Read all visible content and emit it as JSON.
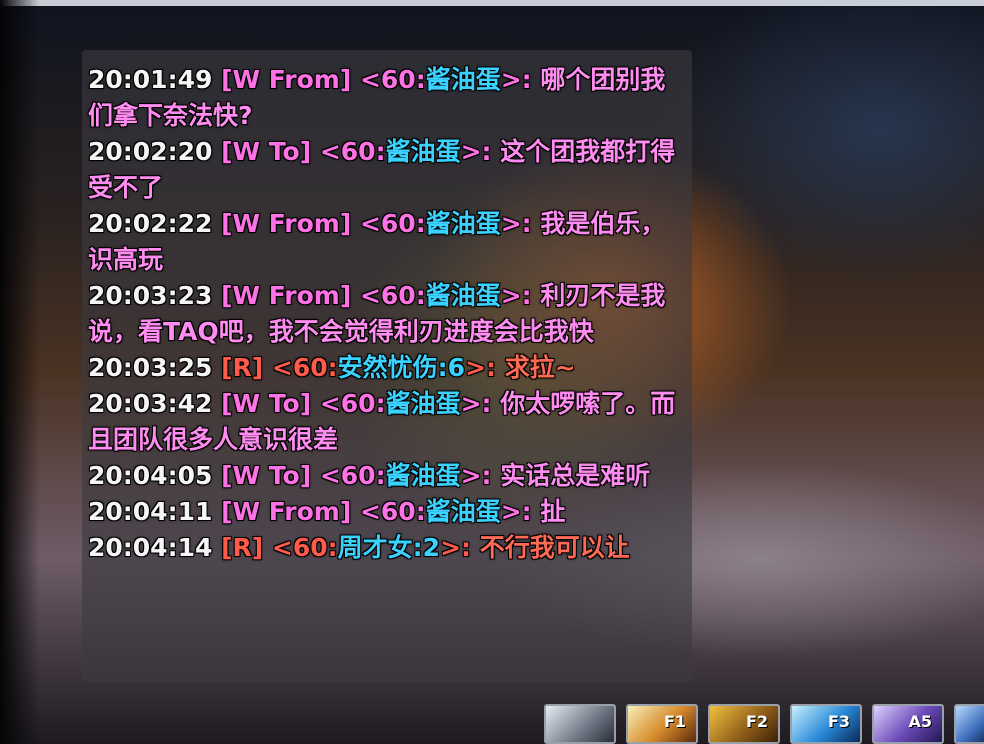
{
  "chat": {
    "messages": [
      {
        "time": "20:01:49",
        "channel": "[W From]",
        "open": " <60:",
        "name": "酱油蛋",
        "close": ">: ",
        "text": "哪个团别我们拿下奈法快?"
      },
      {
        "time": "20:02:20",
        "channel": "[W To]",
        "open": " <60:",
        "name": "酱油蛋",
        "close": ">: ",
        "text": "这个团我都打得受不了"
      },
      {
        "time": "20:02:22",
        "channel": "[W From]",
        "open": " <60:",
        "name": "酱油蛋",
        "close": ">: ",
        "text": "我是伯乐，识高玩"
      },
      {
        "time": "20:03:23",
        "channel": "[W From]",
        "open": " <60:",
        "name": "酱油蛋",
        "close": ">: ",
        "text": "利刃不是我说，看TAQ吧，我不会觉得利刃进度会比我快"
      },
      {
        "time": "20:03:25",
        "channel": "[R]",
        "open": " <60:",
        "name": "安然忧伤:6",
        "close": ">: ",
        "text": "求拉~"
      },
      {
        "time": "20:03:42",
        "channel": "[W To]",
        "open": " <60:",
        "name": "酱油蛋",
        "close": ">: ",
        "text": "你太啰嗦了。而且团队很多人意识很差"
      },
      {
        "time": "20:04:05",
        "channel": "[W To]",
        "open": " <60:",
        "name": "酱油蛋",
        "close": ">: ",
        "text": "实话总是难听"
      },
      {
        "time": "20:04:11",
        "channel": "[W From]",
        "open": " <60:",
        "name": "酱油蛋",
        "close": ">: ",
        "text": "扯"
      },
      {
        "time": "20:04:14",
        "channel": "[R]",
        "open": " <60:",
        "name": "周才女:2",
        "close": ">: ",
        "text": "不行我可以让"
      }
    ]
  },
  "action_bar": {
    "slots": [
      {
        "key": "",
        "icon": "ability-icon"
      },
      {
        "key": "F1",
        "icon": "ability-icon"
      },
      {
        "key": "F2",
        "icon": "ability-icon"
      },
      {
        "key": "F3",
        "icon": "ability-icon"
      },
      {
        "key": "A5",
        "icon": "ability-icon"
      },
      {
        "key": "",
        "icon": "ability-icon"
      }
    ]
  },
  "colors": {
    "timestamp": "#f5f5f5",
    "whisper": "#ff72e6",
    "raid": "#ff5a4a",
    "player_name": "#3ad2ff"
  }
}
